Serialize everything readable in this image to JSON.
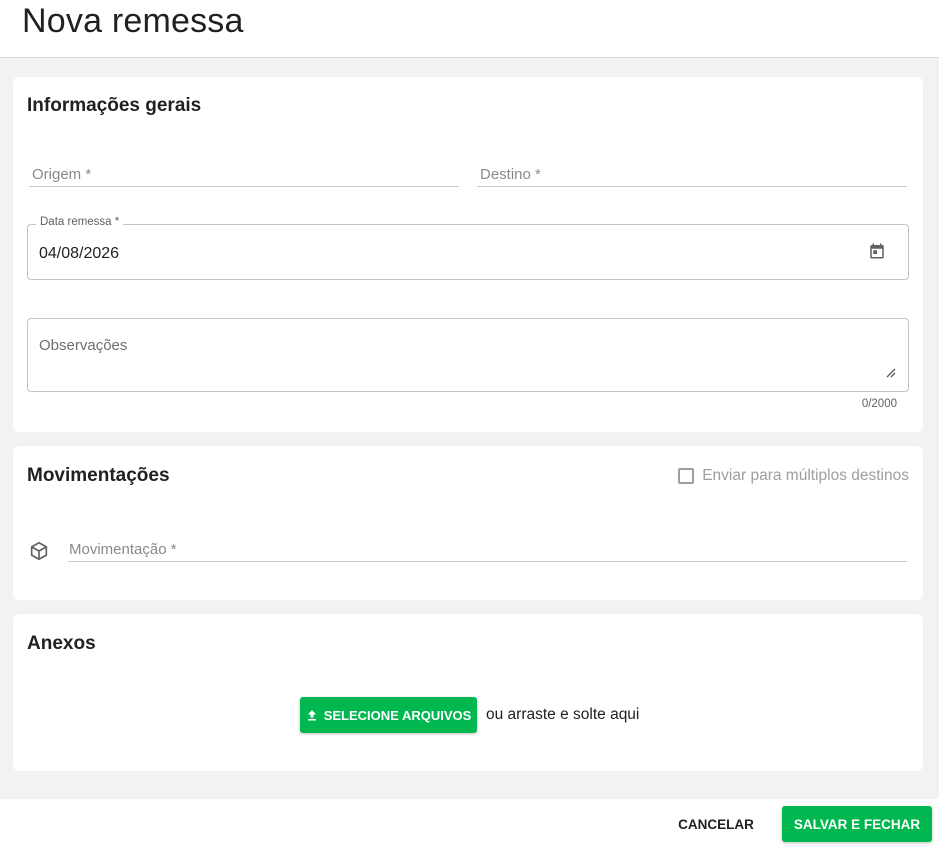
{
  "header": {
    "title": "Nova remessa"
  },
  "general": {
    "title": "Informações gerais",
    "origin_label": "Origem *",
    "destination_label": "Destino *",
    "date_label": "Data remessa *",
    "date_value": "04/08/2026",
    "date_icon": "calendar-icon",
    "notes_label": "Observações",
    "notes_value": "",
    "notes_counter": "0/2000"
  },
  "movements": {
    "title": "Movimentações",
    "multi_dest_label": "Enviar para múltiplos destinos",
    "multi_dest_checked": false,
    "movement_label": "Movimentação *",
    "movement_icon": "box-icon"
  },
  "attachments": {
    "title": "Anexos",
    "upload_button_label": "SELECIONE ARQUIVOS",
    "upload_icon": "upload-icon",
    "drop_hint": "ou arraste e solte aqui"
  },
  "footer": {
    "cancel_label": "CANCELAR",
    "save_label": "SALVAR E FECHAR"
  },
  "colors": {
    "accent": "#00b84f",
    "background": "#f2f2f2",
    "card": "#ffffff"
  }
}
